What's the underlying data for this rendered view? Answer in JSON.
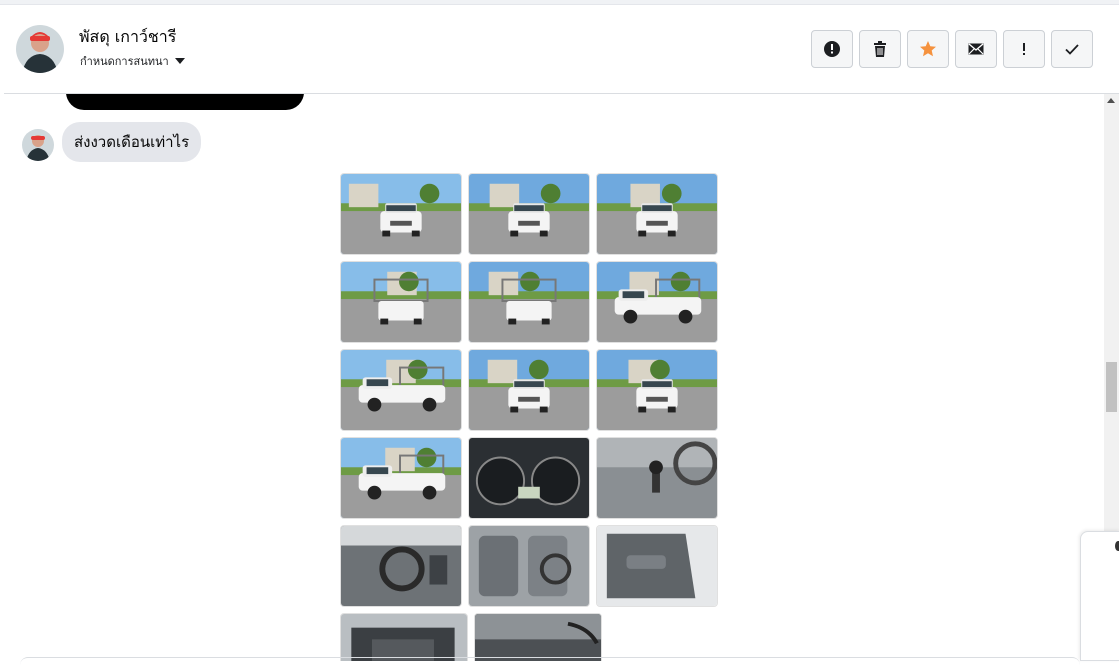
{
  "header": {
    "contact_name": "พัสดุ เกาว์ชารี",
    "subtitle": "กำหนดการสนทนา",
    "actions": [
      {
        "name": "report-button",
        "icon": "alert-circle-icon"
      },
      {
        "name": "delete-button",
        "icon": "trash-icon"
      },
      {
        "name": "star-button",
        "icon": "star-icon"
      },
      {
        "name": "mark-unread-button",
        "icon": "envelope-icon"
      },
      {
        "name": "important-button",
        "icon": "exclamation-icon"
      },
      {
        "name": "done-button",
        "icon": "checkmark-icon"
      }
    ]
  },
  "messages": [
    {
      "type": "text",
      "text": "ส่งงวดเดือนเท่าไร"
    }
  ],
  "photos": [
    {
      "subject": "white-pickup-truck-front"
    },
    {
      "subject": "white-pickup-truck-front-left"
    },
    {
      "subject": "white-pickup-truck-front"
    },
    {
      "subject": "white-pickup-truck-rear-left"
    },
    {
      "subject": "white-pickup-truck-rear"
    },
    {
      "subject": "white-pickup-truck-side"
    },
    {
      "subject": "white-pickup-truck-side"
    },
    {
      "subject": "white-pickup-truck-front-right"
    },
    {
      "subject": "white-pickup-truck-front-left"
    },
    {
      "subject": "white-pickup-truck-side"
    },
    {
      "subject": "instrument-cluster"
    },
    {
      "subject": "gear-shift"
    },
    {
      "subject": "dashboard"
    },
    {
      "subject": "interior-seats"
    },
    {
      "subject": "door-panel"
    },
    {
      "subject": "engine-bay"
    },
    {
      "subject": "interior-trim"
    }
  ],
  "colors": {
    "star_accent": "#f5923e",
    "bubble_bg": "#e4e6eb",
    "button_bg": "#f5f6f7"
  }
}
